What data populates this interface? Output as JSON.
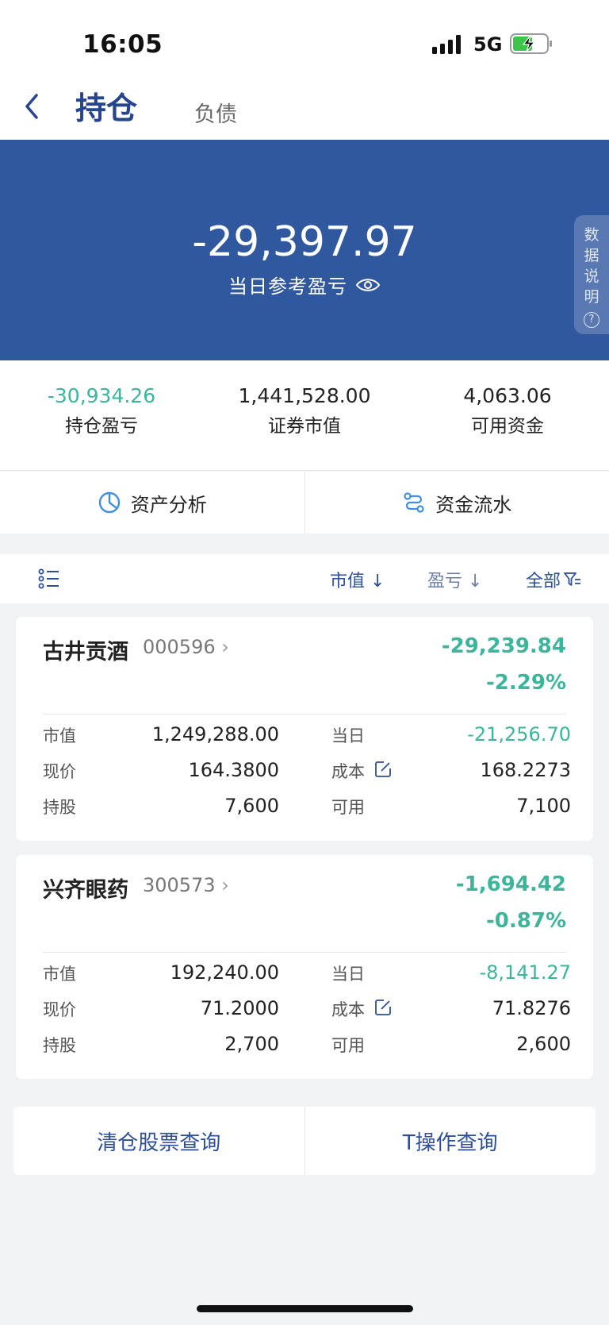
{
  "status_bar": {
    "time": "16:05",
    "network": "5G"
  },
  "header": {
    "active_tab": "持仓",
    "other_tab": "负债"
  },
  "hero": {
    "value": "-29,397.97",
    "label": "当日参考盈亏",
    "side_tab": [
      "数",
      "据",
      "说",
      "明"
    ],
    "side_tab_help": "?"
  },
  "stats": [
    {
      "value": "-30,934.26",
      "label": "持仓盈亏",
      "color": "#3bb69a"
    },
    {
      "value": "1,441,528.00",
      "label": "证券市值"
    },
    {
      "value": "4,063.06",
      "label": "可用资金"
    }
  ],
  "actions": {
    "asset_analysis": "资产分析",
    "fund_flow": "资金流水"
  },
  "sort_bar": {
    "market_value": "市值 ↓",
    "profit_loss": "盈亏 ↓",
    "filter": "全部"
  },
  "positions": [
    {
      "name": "古井贡酒",
      "code": "000596",
      "pl": "-29,239.84",
      "pl_pct": "-2.29%",
      "market_value_label": "市值",
      "market_value": "1,249,288.00",
      "today_label": "当日",
      "today": "-21,256.70",
      "price_label": "现价",
      "price": "164.3800",
      "cost_label": "成本",
      "cost": "168.2273",
      "holding_label": "持股",
      "holding": "7,600",
      "available_label": "可用",
      "available": "7,100"
    },
    {
      "name": "兴齐眼药",
      "code": "300573",
      "pl": "-1,694.42",
      "pl_pct": "-0.87%",
      "market_value_label": "市值",
      "market_value": "192,240.00",
      "today_label": "当日",
      "today": "-8,141.27",
      "price_label": "现价",
      "price": "71.2000",
      "cost_label": "成本",
      "cost": "71.8276",
      "holding_label": "持股",
      "holding": "2,700",
      "available_label": "可用",
      "available": "2,600"
    }
  ],
  "bottom_buttons": {
    "cleared_stocks": "清仓股票查询",
    "t_ops": "T操作查询"
  },
  "colors": {
    "brand_blue": "#30589f",
    "loss_green": "#3bb69a",
    "link_blue": "#2c4e9b"
  }
}
